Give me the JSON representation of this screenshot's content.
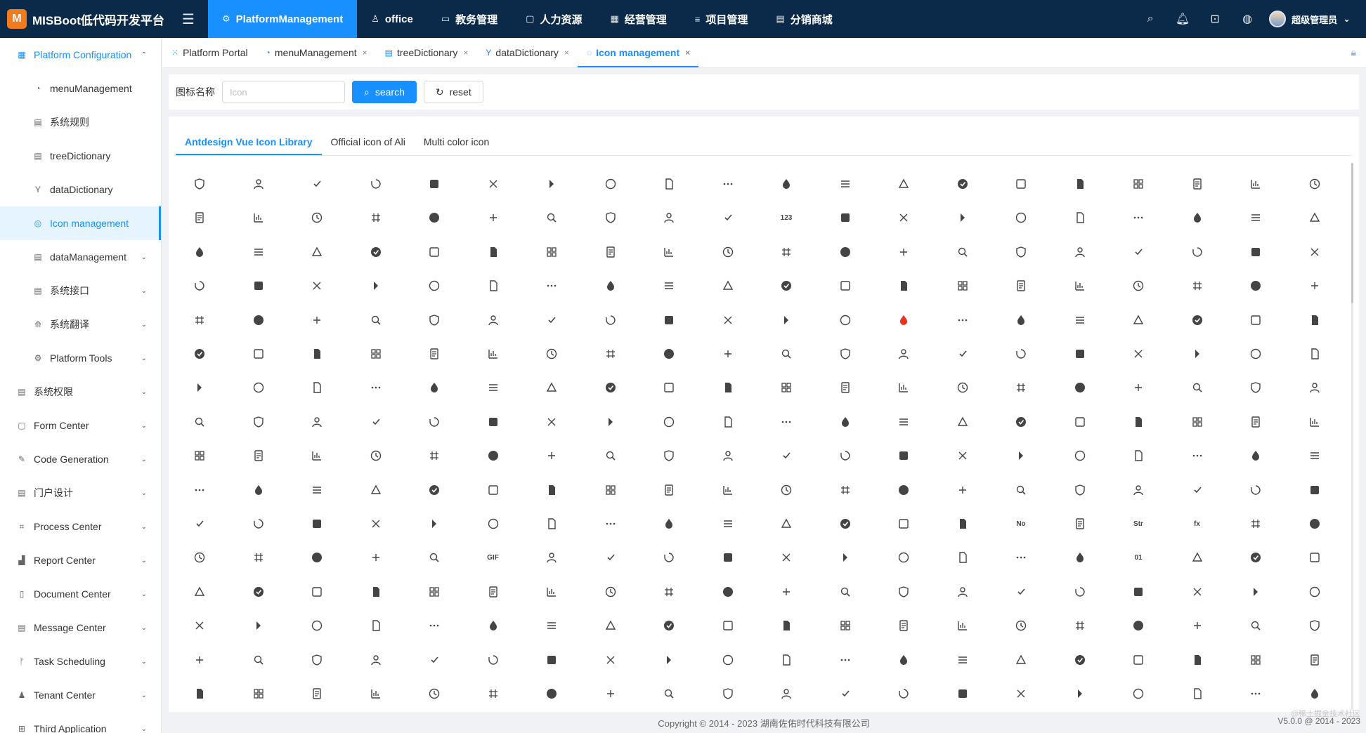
{
  "app": {
    "name": "MISBoot低代码开发平台",
    "logo_letter": "M"
  },
  "topnav": [
    {
      "label": "PlatformManagement",
      "icon": "⚙",
      "active": true
    },
    {
      "label": "office",
      "icon": "♙",
      "active": false
    },
    {
      "label": "教务管理",
      "icon": "▭",
      "active": false
    },
    {
      "label": "人力资源",
      "icon": "▢",
      "active": false
    },
    {
      "label": "经营管理",
      "icon": "▦",
      "active": false
    },
    {
      "label": "项目管理",
      "icon": "≡",
      "active": false
    },
    {
      "label": "分销商城",
      "icon": "▤",
      "active": false
    }
  ],
  "user": {
    "name": "超级管理员"
  },
  "sidebar": {
    "items": [
      {
        "label": "Platform Configuration",
        "level": 0,
        "open": true,
        "icon": "▦"
      },
      {
        "label": "menuManagement",
        "level": 1,
        "icon": "◔"
      },
      {
        "label": "系统规则",
        "level": 1,
        "icon": "▤"
      },
      {
        "label": "treeDictionary",
        "level": 1,
        "icon": "▤"
      },
      {
        "label": "dataDictionary",
        "level": 1,
        "icon": "Y"
      },
      {
        "label": "Icon management",
        "level": 1,
        "active": true,
        "icon": "◎"
      },
      {
        "label": "dataManagement",
        "level": 1,
        "chevron": true,
        "icon": "▤"
      },
      {
        "label": "系统接口",
        "level": 1,
        "chevron": true,
        "icon": "▤"
      },
      {
        "label": "系统翻译",
        "level": 1,
        "chevron": true,
        "icon": "⟰"
      },
      {
        "label": "Platform Tools",
        "level": 1,
        "chevron": true,
        "icon": "⚙"
      },
      {
        "label": "系统权限",
        "level": 0,
        "chevron": true,
        "icon": "▤"
      },
      {
        "label": "Form Center",
        "level": 0,
        "chevron": true,
        "icon": "▢"
      },
      {
        "label": "Code Generation",
        "level": 0,
        "chevron": true,
        "icon": "✎"
      },
      {
        "label": "门户设计",
        "level": 0,
        "chevron": true,
        "icon": "▤"
      },
      {
        "label": "Process Center",
        "level": 0,
        "chevron": true,
        "icon": "⌗"
      },
      {
        "label": "Report Center",
        "level": 0,
        "chevron": true,
        "icon": "▟"
      },
      {
        "label": "Document Center",
        "level": 0,
        "chevron": true,
        "icon": "▯"
      },
      {
        "label": "Message Center",
        "level": 0,
        "chevron": true,
        "icon": "▤"
      },
      {
        "label": "Task Scheduling",
        "level": 0,
        "chevron": true,
        "icon": "ᚠ"
      },
      {
        "label": "Tenant Center",
        "level": 0,
        "chevron": true,
        "icon": "♟"
      },
      {
        "label": "Third Application",
        "level": 0,
        "chevron": true,
        "icon": "⊞"
      }
    ]
  },
  "tabs": [
    {
      "label": "Platform Portal",
      "icon": "⁙",
      "closable": false
    },
    {
      "label": "menuManagement",
      "icon": "◔",
      "closable": true
    },
    {
      "label": "treeDictionary",
      "icon": "▤",
      "closable": true
    },
    {
      "label": "dataDictionary",
      "icon": "Y",
      "closable": true
    },
    {
      "label": "Icon management",
      "icon": "◌",
      "closable": true,
      "active": true
    }
  ],
  "search": {
    "label": "图标名称",
    "placeholder": "Icon",
    "value": "",
    "search_label": "search",
    "reset_label": "reset"
  },
  "libtabs": [
    {
      "label": "Antdesign Vue Icon Library",
      "active": true
    },
    {
      "label": "Official icon of Ali",
      "active": false
    },
    {
      "label": "Multi color icon",
      "active": false
    }
  ],
  "icon_grid": {
    "columns": 20,
    "rows": 16
  },
  "icon_text_glyphs": {
    "r1c10": "123",
    "r10c14": "No",
    "r11c5": "GIF",
    "r11c16": "01",
    "r10c17": "fx",
    "r10c16": "Str"
  },
  "footer": {
    "copyright": "Copyright © 2014 - 2023 湖南佐佑时代科技有限公司",
    "version": "V5.0.0 @ 2014 - 2023",
    "watermark": "@稀土掘金技术社区"
  },
  "colors": {
    "accent": "#1890ff",
    "topbar": "#0b2a4a",
    "flame": "#e8331f"
  }
}
